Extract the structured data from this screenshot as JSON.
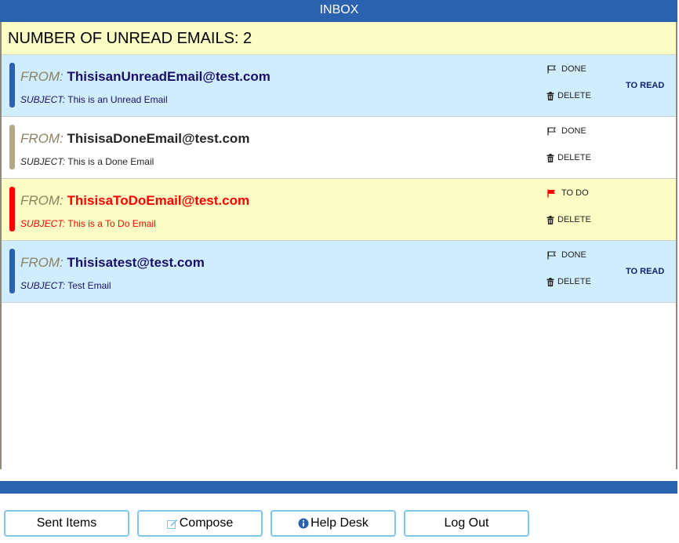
{
  "header": {
    "title": "INBOX"
  },
  "unread": {
    "label": "NUMBER OF UNREAD EMAILS: 2"
  },
  "labels": {
    "from": "FROM:",
    "subject": "SUBJECT:",
    "delete": "DELETE",
    "to_read": "TO READ"
  },
  "emails": [
    {
      "status": "unread",
      "from": "ThisisanUnreadEmail@test.com",
      "subject": "This is an Unread Email",
      "flag_label": "DONE",
      "show_to_read": true,
      "accent_color": "#2b62b0",
      "address_color": "#1a0f6b",
      "subject_color": "#1a0f6b"
    },
    {
      "status": "done",
      "from": "ThisisaDoneEmail@test.com",
      "subject": "This is a Done Email",
      "flag_label": "DONE",
      "show_to_read": false,
      "accent_color": "#b3a986",
      "address_color": "#262626",
      "subject_color": "#262626"
    },
    {
      "status": "todo",
      "from": "ThisisaToDoEmail@test.com",
      "subject": "This is a To Do Email",
      "flag_label": "TO DO",
      "show_to_read": false,
      "accent_color": "#ff0000",
      "address_color": "#ff0000",
      "subject_color": "#ff0000"
    },
    {
      "status": "unread",
      "from": "Thisisatest@test.com",
      "subject": "Test Email",
      "flag_label": "DONE",
      "show_to_read": true,
      "accent_color": "#2b62b0",
      "address_color": "#1a0f6b",
      "subject_color": "#1a0f6b"
    }
  ],
  "buttons": {
    "sent_items": "Sent Items",
    "compose": "Compose",
    "help_desk": "Help Desk",
    "log_out": "Log Out"
  },
  "icons": {
    "flag_outline": "flag-outline-icon",
    "flag_filled": "flag-filled-icon",
    "trash": "trash-icon",
    "compose": "edit-icon",
    "help": "info-icon"
  },
  "colors": {
    "brand_blue": "#2b62b0",
    "unread_bg": "#cfedfc",
    "todo_bg": "#fbfdc5",
    "button_border": "#7fc6ec"
  }
}
